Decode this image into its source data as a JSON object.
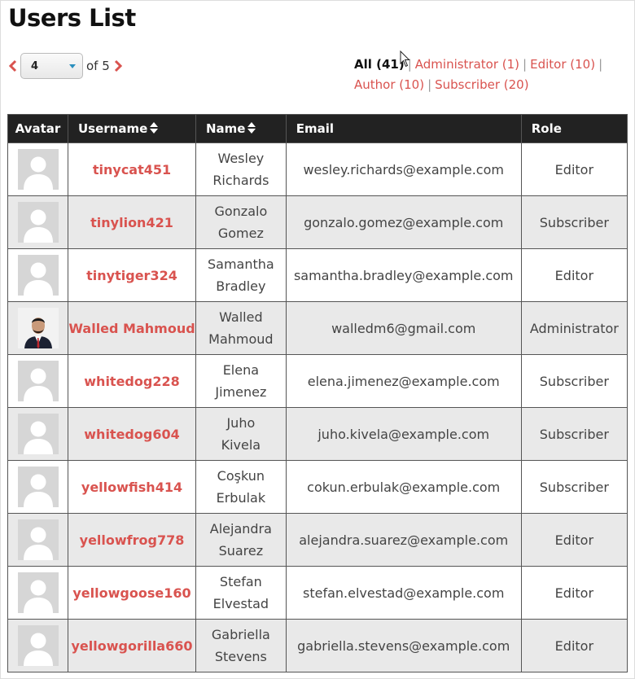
{
  "page": {
    "title": "Users List"
  },
  "pager": {
    "current_page": "4",
    "of_text": "of 5"
  },
  "role_filters": [
    {
      "label": "All (41)",
      "current": true
    },
    {
      "label": "Administrator (1)",
      "current": false
    },
    {
      "label": "Editor (10)",
      "current": false
    },
    {
      "label": "Author (10)",
      "current": false
    },
    {
      "label": "Subscriber (20)",
      "current": false
    }
  ],
  "table": {
    "columns": [
      "Avatar",
      "Username",
      "Name",
      "Email",
      "Role"
    ],
    "rows": [
      {
        "username": "tinycat451",
        "name": "Wesley Richards",
        "email": "wesley.richards@example.com",
        "role": "Editor",
        "avatar": "default"
      },
      {
        "username": "tinylion421",
        "name": "Gonzalo Gomez",
        "email": "gonzalo.gomez@example.com",
        "role": "Subscriber",
        "avatar": "default"
      },
      {
        "username": "tinytiger324",
        "name": "Samantha Bradley",
        "email": "samantha.bradley@example.com",
        "role": "Editor",
        "avatar": "default"
      },
      {
        "username": "Walled Mahmoud",
        "name": "Walled Mahmoud",
        "email": "walledm6@gmail.com",
        "role": "Administrator",
        "avatar": "photo"
      },
      {
        "username": "whitedog228",
        "name": "Elena Jimenez",
        "email": "elena.jimenez@example.com",
        "role": "Subscriber",
        "avatar": "default"
      },
      {
        "username": "whitedog604",
        "name": "Juho Kivela",
        "email": "juho.kivela@example.com",
        "role": "Subscriber",
        "avatar": "default"
      },
      {
        "username": "yellowfish414",
        "name": "Coşkun Erbulak",
        "email": "cokun.erbulak@example.com",
        "role": "Subscriber",
        "avatar": "default"
      },
      {
        "username": "yellowfrog778",
        "name": "Alejandra Suarez",
        "email": "alejandra.suarez@example.com",
        "role": "Editor",
        "avatar": "default"
      },
      {
        "username": "yellowgoose160",
        "name": "Stefan Elvestad",
        "email": "stefan.elvestad@example.com",
        "role": "Editor",
        "avatar": "default"
      },
      {
        "username": "yellowgorilla660",
        "name": "Gabriella Stevens",
        "email": "gabriella.stevens@example.com",
        "role": "Editor",
        "avatar": "default"
      }
    ]
  },
  "colors": {
    "accent": "#d9534f",
    "header_bg": "#222222",
    "row_alt": "#e9e9e9",
    "caret": "#2a8fbd"
  },
  "icons": {
    "prev": "chevron-left-icon",
    "next": "chevron-right-icon",
    "sort": "sort-icon",
    "avatar_default": "default-avatar-icon"
  }
}
